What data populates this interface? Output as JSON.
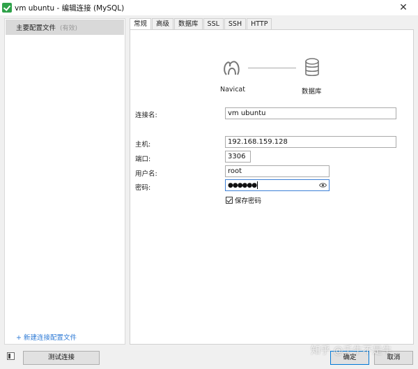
{
  "window": {
    "title": "vm ubuntu - 编辑连接 (MySQL)",
    "close_glyph": "✕"
  },
  "sidebar": {
    "profile_name": "主要配置文件",
    "profile_status": "(有效)",
    "new_profile_link": "+ 新建连接配置文件"
  },
  "tabs": [
    "常规",
    "高级",
    "数据库",
    "SSL",
    "SSH",
    "HTTP"
  ],
  "active_tab": "常规",
  "flow": {
    "source_label": "Navicat",
    "target_label": "数据库"
  },
  "form": {
    "connection_name_label": "连接名:",
    "connection_name_value": "vm ubuntu",
    "host_label": "主机:",
    "host_value": "192.168.159.128",
    "port_label": "端口:",
    "port_value": "3306",
    "username_label": "用户名:",
    "username_value": "root",
    "password_label": "密码:",
    "password_masked": "●●●●●●",
    "save_password_label": "保存密码",
    "save_password_checked": true
  },
  "footer": {
    "test_connection_button": "测试连接",
    "ok_button": "确定",
    "cancel_button": "取消"
  },
  "watermark": "知乎 @千牛不是牛",
  "colors": {
    "accent": "#0078d7",
    "link": "#2f7bd6",
    "app_icon": "#2fa24a"
  }
}
